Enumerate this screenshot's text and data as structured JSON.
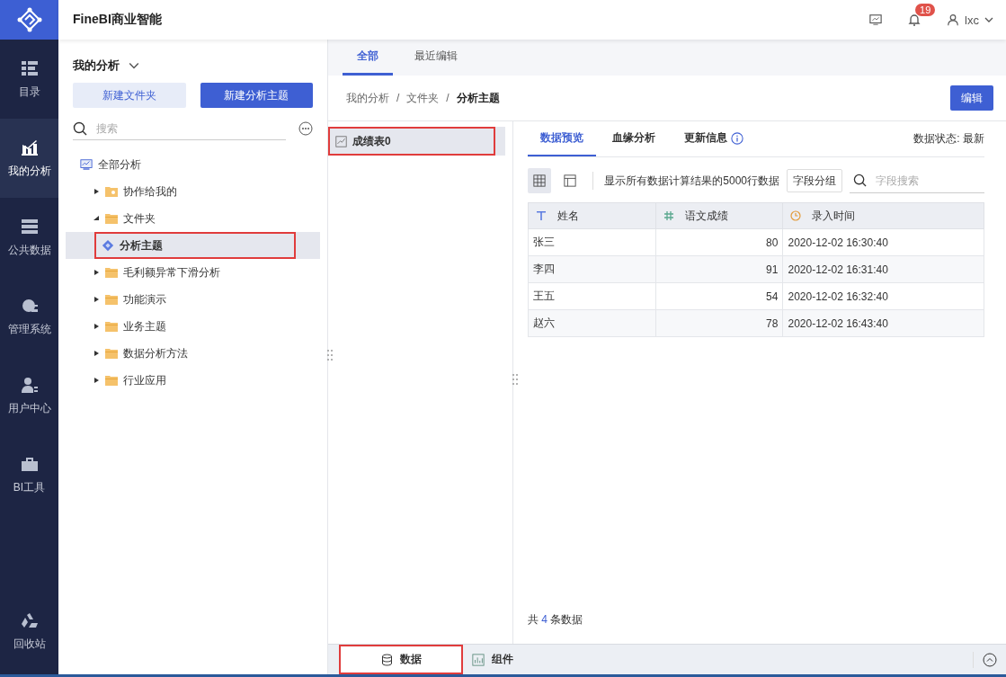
{
  "app": {
    "title": "FineBI商业智能",
    "notifications": "19",
    "user": "lxc"
  },
  "nav": [
    {
      "label": "目录",
      "kind": "catalog",
      "selected": false
    },
    {
      "label": "我的分析",
      "kind": "analysis",
      "selected": true
    },
    {
      "label": "公共数据",
      "kind": "data",
      "selected": false
    },
    {
      "label": "管理系统",
      "kind": "gear",
      "selected": false
    },
    {
      "label": "用户中心",
      "kind": "user",
      "selected": false
    },
    {
      "label": "BI工具",
      "kind": "toolbox",
      "selected": false
    },
    {
      "label": "回收站",
      "kind": "recycle",
      "selected": false
    }
  ],
  "tree_panel": {
    "title": "我的分析",
    "buttons": [
      {
        "label": "新建文件夹",
        "kind": "secondary"
      },
      {
        "label": "新建分析主题",
        "kind": "primary"
      }
    ],
    "search": {
      "placeholder": "搜索"
    },
    "tree": [
      {
        "label": "全部分析",
        "kind": "root",
        "selected": false,
        "highlighted": false,
        "children": [
          {
            "label": "协作给我的",
            "kind": "shared",
            "expanded": false,
            "selected": false,
            "highlighted": false
          },
          {
            "label": "文件夹",
            "kind": "folder",
            "expanded": true,
            "selected": false,
            "highlighted": false,
            "children": [
              {
                "label": "分析主题",
                "kind": "subject",
                "selected": true,
                "highlighted": true
              }
            ]
          },
          {
            "label": "毛利额异常下滑分析",
            "kind": "folder",
            "expanded": false,
            "selected": false,
            "highlighted": false
          },
          {
            "label": "功能演示",
            "kind": "folder",
            "expanded": false,
            "selected": false,
            "highlighted": false
          },
          {
            "label": "业务主题",
            "kind": "folder",
            "expanded": false,
            "selected": false,
            "highlighted": false
          },
          {
            "label": "数据分析方法",
            "kind": "folder",
            "expanded": false,
            "selected": false,
            "highlighted": false
          },
          {
            "label": "行业应用",
            "kind": "folder",
            "expanded": false,
            "selected": false,
            "highlighted": false
          }
        ]
      }
    ]
  },
  "top_tabs": [
    {
      "label": "全部",
      "selected": true
    },
    {
      "label": "最近编辑",
      "selected": false
    }
  ],
  "breadcrumb": {
    "separator": "/",
    "items": [
      "我的分析",
      "文件夹",
      "分析主题"
    ]
  },
  "edit_button": "编辑",
  "tables": [
    {
      "label": "成绩表0",
      "selected": true,
      "highlighted": true
    }
  ],
  "detail_tabs": [
    {
      "label": "数据预览",
      "selected": true,
      "info": false
    },
    {
      "label": "血缘分析",
      "selected": false,
      "info": false
    },
    {
      "label": "更新信息",
      "selected": false,
      "info": true
    }
  ],
  "data_status": "数据状态: 最新",
  "view_modes": [
    {
      "kind": "grid",
      "selected": true
    },
    {
      "kind": "layout",
      "selected": false
    }
  ],
  "info_text": "显示所有数据计算结果的5000行数据",
  "group_button": "字段分组",
  "field_search": {
    "placeholder": "字段搜索"
  },
  "table": {
    "columns": [
      {
        "label": "姓名",
        "kind": "text"
      },
      {
        "label": "语文成绩",
        "kind": "number"
      },
      {
        "label": "录入时间",
        "kind": "time"
      }
    ],
    "rows": [
      [
        "张三",
        "80",
        "2020-12-02 16:30:40"
      ],
      [
        "李四",
        "91",
        "2020-12-02 16:31:40"
      ],
      [
        "王五",
        "54",
        "2020-12-02 16:32:40"
      ],
      [
        "赵六",
        "78",
        "2020-12-02 16:43:40"
      ]
    ]
  },
  "total": {
    "prefix": "共",
    "count": "4",
    "suffix": "条数据"
  },
  "bottom_tabs": [
    {
      "label": "数据",
      "kind": "data",
      "selected": true,
      "highlighted": true
    },
    {
      "label": "组件",
      "kind": "chart",
      "selected": false,
      "highlighted": false
    }
  ]
}
